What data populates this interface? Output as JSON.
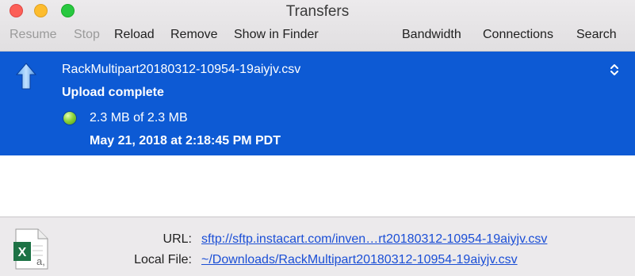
{
  "window": {
    "title": "Transfers"
  },
  "toolbar": {
    "resume_label": "Resume",
    "stop_label": "Stop",
    "reload_label": "Reload",
    "remove_label": "Remove",
    "show_in_finder_label": "Show in Finder",
    "bandwidth_label": "Bandwidth",
    "connections_label": "Connections",
    "search_label": "Search"
  },
  "transfer": {
    "file_name": "RackMultipart20180312-10954-19aiyjv.csv",
    "status": "Upload complete",
    "size": "2.3 MB of 2.3 MB",
    "date": "May 21, 2018 at 2:18:45 PM PDT",
    "status_color": "#7ed321",
    "icon": "upload-arrow-icon"
  },
  "info": {
    "url_label": "URL:",
    "url_value": "sftp://sftp.instacart.com/inven…rt20180312-10954-19aiyjv.csv",
    "local_file_label": "Local File:",
    "local_file_value": "~/Downloads/RackMultipart20180312-10954-19aiyjv.csv",
    "file_icon": "excel-file-icon"
  },
  "colors": {
    "selection": "#0d5ad4",
    "link": "#1b4fd6"
  }
}
